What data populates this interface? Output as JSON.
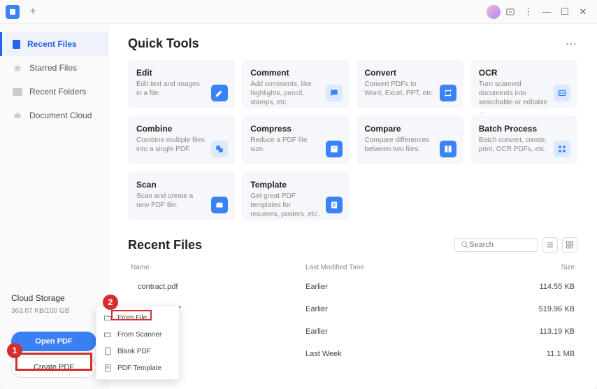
{
  "titlebar": {
    "add_tab": "+"
  },
  "sidebar": {
    "items": [
      {
        "label": "Recent Files"
      },
      {
        "label": "Starred Files"
      },
      {
        "label": "Recent Folders"
      },
      {
        "label": "Document Cloud"
      }
    ],
    "cloud_storage_label": "Cloud Storage",
    "cloud_storage_value": "363.07 KB/100 GB",
    "open_pdf_label": "Open PDF",
    "create_pdf_label": "Create PDF"
  },
  "quick_tools": {
    "title": "Quick Tools",
    "tools": [
      {
        "title": "Edit",
        "desc": "Edit text and images in a file."
      },
      {
        "title": "Comment",
        "desc": "Add comments, like highlights, pencil, stamps, etc."
      },
      {
        "title": "Convert",
        "desc": "Convert PDFs to Word, Excel, PPT, etc."
      },
      {
        "title": "OCR",
        "desc": "Turn scanned documents into searchable or editable ..."
      },
      {
        "title": "Combine",
        "desc": "Combine multiple files into a single PDF."
      },
      {
        "title": "Compress",
        "desc": "Reduce a PDF file size."
      },
      {
        "title": "Compare",
        "desc": "Compare differences between two files."
      },
      {
        "title": "Batch Process",
        "desc": "Batch convert, create, print, OCR PDFs, etc."
      },
      {
        "title": "Scan",
        "desc": "Scan and create a new PDF file."
      },
      {
        "title": "Template",
        "desc": "Get great PDF templates for resumes, posters, etc."
      }
    ]
  },
  "recent_files": {
    "title": "Recent Files",
    "search_placeholder": "Search",
    "columns": {
      "name": "Name",
      "time": "Last Modified Time",
      "size": "Size"
    },
    "files": [
      {
        "name": "contract.pdf",
        "time": "Earlier",
        "size": "114.55 KB"
      },
      {
        "name": "Architect.pdf",
        "time": "Earlier",
        "size": "519.96 KB"
      },
      {
        "name": "",
        "time": "Earlier",
        "size": "113.19 KB"
      },
      {
        "name": "",
        "time": "Last Week",
        "size": "11.1 MB"
      }
    ]
  },
  "context_menu": {
    "items": [
      {
        "label": "From File"
      },
      {
        "label": "From Scanner"
      },
      {
        "label": "Blank PDF"
      },
      {
        "label": "PDF Template"
      }
    ]
  },
  "annotations": {
    "badge1": "1",
    "badge2": "2"
  }
}
